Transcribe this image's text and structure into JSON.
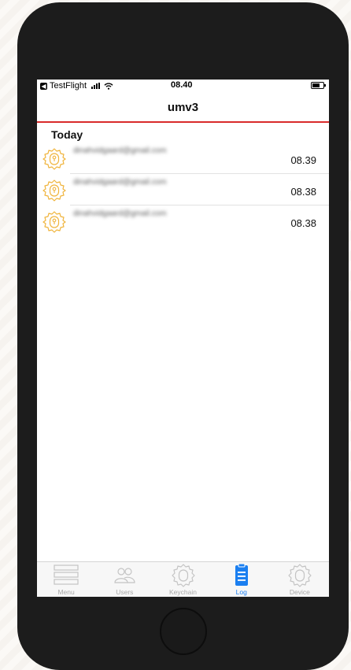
{
  "status_bar": {
    "back_app": "TestFlight",
    "time": "08.40"
  },
  "nav": {
    "title": "umv3"
  },
  "log": {
    "section_header": "Today",
    "entries": [
      {
        "email": "dinahvidgaard@gmail.com",
        "time": "08.39",
        "icon": "keyhole-gear-icon"
      },
      {
        "email": "dinahvidgaard@gmail.com",
        "time": "08.38",
        "icon": "keyhole-gear-icon"
      },
      {
        "email": "dinahvidgaard@gmail.com",
        "time": "08.38",
        "icon": "keyhole-gear-icon"
      }
    ]
  },
  "tabs": [
    {
      "label": "Menu",
      "icon": "menu-icon",
      "active": false
    },
    {
      "label": "Users",
      "icon": "users-icon",
      "active": false
    },
    {
      "label": "Keychain",
      "icon": "keychain-gear-icon",
      "active": false
    },
    {
      "label": "Log",
      "icon": "log-clipboard-icon",
      "active": true
    },
    {
      "label": "Device",
      "icon": "device-gear-icon",
      "active": false
    }
  ],
  "colors": {
    "accent_red": "#d92b2b",
    "active_tab_blue": "#1b7ff0",
    "inactive_tab_gray": "#a9a9a9",
    "log_icon_orange": "#f0b43c"
  }
}
